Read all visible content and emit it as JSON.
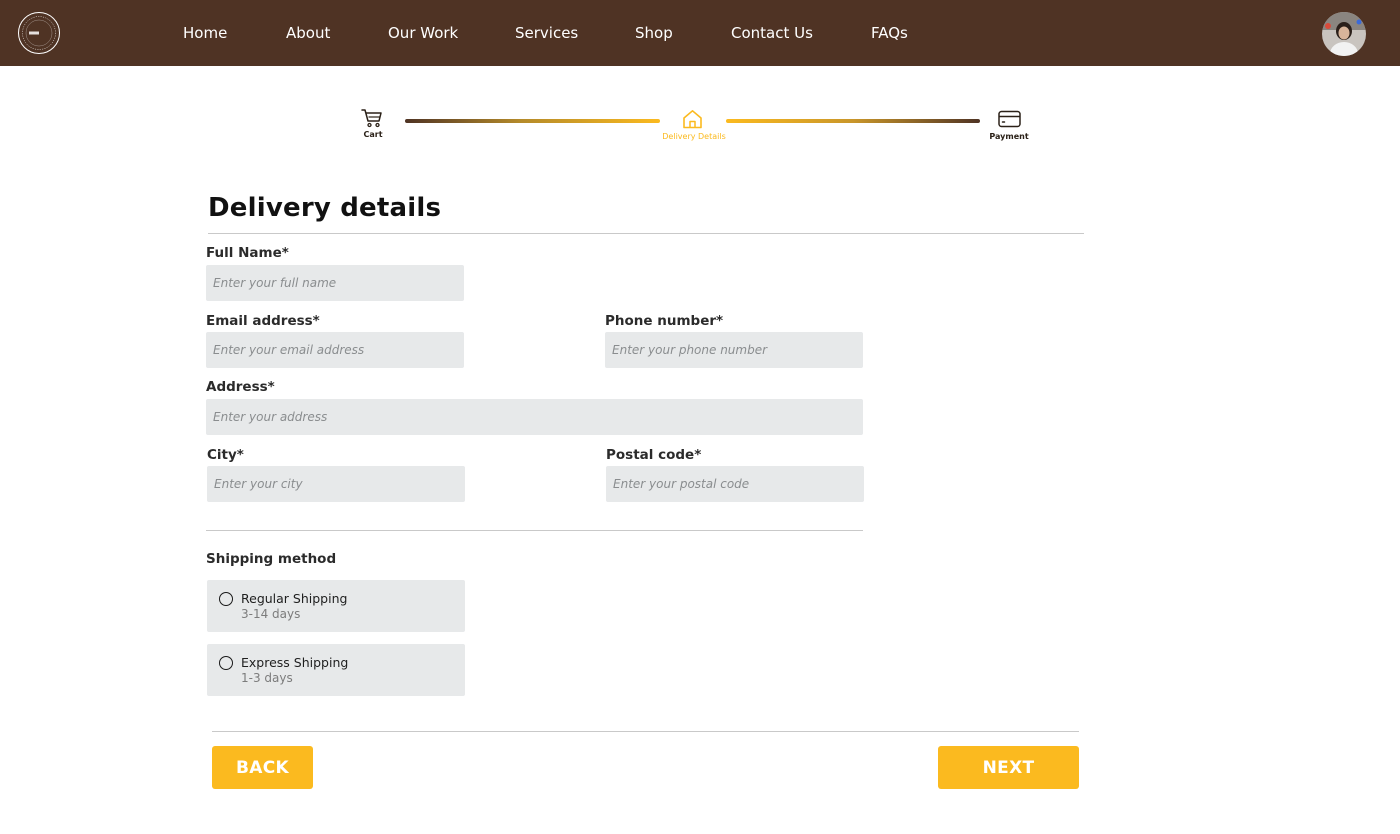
{
  "colors": {
    "nav_background": "#4f3324",
    "accent": "#fbba1f",
    "field_background": "#e7e9ea"
  },
  "nav": {
    "links": [
      "Home",
      "About",
      "Our Work",
      "Services",
      "Shop",
      "Contact Us",
      "FAQs"
    ],
    "logo_icon": "circular-brand-logo",
    "avatar_icon": "user-avatar"
  },
  "stepper": {
    "steps": [
      {
        "label": "Cart",
        "icon": "cart-icon",
        "state": "completed"
      },
      {
        "label": "Delivery Details",
        "icon": "home-icon",
        "state": "active"
      },
      {
        "label": "Payment",
        "icon": "credit-card-icon",
        "state": "upcoming"
      }
    ]
  },
  "form": {
    "title": "Delivery details",
    "full_name": {
      "label": "Full Name*",
      "placeholder": "Enter your full name",
      "value": ""
    },
    "email": {
      "label": "Email address*",
      "placeholder": "Enter your email address",
      "value": ""
    },
    "phone": {
      "label": "Phone number*",
      "placeholder": "Enter your phone number",
      "value": ""
    },
    "address": {
      "label": "Address*",
      "placeholder": "Enter your address",
      "value": ""
    },
    "city": {
      "label": "City*",
      "placeholder": "Enter your city",
      "value": ""
    },
    "postal": {
      "label": "Postal code*",
      "placeholder": "Enter your postal code",
      "value": ""
    }
  },
  "shipping": {
    "title": "Shipping method",
    "options": [
      {
        "name": "Regular Shipping",
        "days": "3-14 days",
        "selected": false
      },
      {
        "name": "Express Shipping",
        "days": "1-3 days",
        "selected": false
      }
    ]
  },
  "actions": {
    "back_label": "BACK",
    "next_label": "NEXT"
  }
}
